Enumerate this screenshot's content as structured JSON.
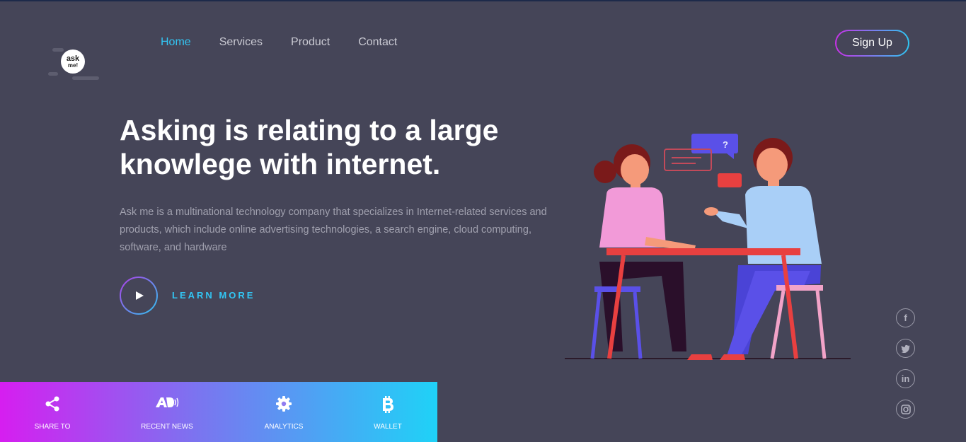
{
  "logo": {
    "line1": "ask",
    "line2": "me!"
  },
  "nav": {
    "items": [
      {
        "label": "Home",
        "active": true
      },
      {
        "label": "Services",
        "active": false
      },
      {
        "label": "Product",
        "active": false
      },
      {
        "label": "Contact",
        "active": false
      }
    ]
  },
  "header": {
    "signup_label": "Sign Up"
  },
  "hero": {
    "headline_line1": "Asking is relating to a large",
    "headline_line2": "knowlege with internet.",
    "description": "Ask me is a multinational technology company that specializes in Internet-related services and products, which include online advertising technologies, a search engine, cloud computing, software, and hardware",
    "learn_more": "LEARN MORE",
    "speech_text": "?"
  },
  "social": {
    "icons": [
      "facebook-icon",
      "twitter-icon",
      "linkedin-icon",
      "instagram-icon"
    ]
  },
  "bottom_bar": {
    "items": [
      {
        "label": "SHARE TO",
        "icon": "share-icon"
      },
      {
        "label": "RECENT NEWS",
        "icon": "ad-icon"
      },
      {
        "label": "ANALYTICS",
        "icon": "gear-icon"
      },
      {
        "label": "WALLET",
        "icon": "bitcoin-icon"
      }
    ]
  },
  "colors": {
    "background": "#454558",
    "accent": "#32c6f4",
    "gradient_start": "#d61ef0",
    "gradient_end": "#1fd2f7"
  }
}
